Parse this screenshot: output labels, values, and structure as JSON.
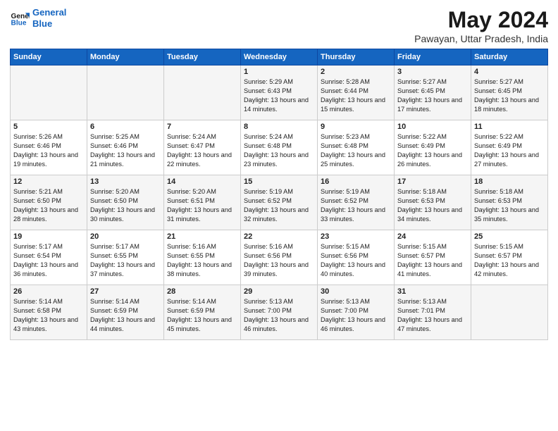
{
  "logo": {
    "line1": "General",
    "line2": "Blue"
  },
  "title": "May 2024",
  "location": "Pawayan, Uttar Pradesh, India",
  "days_of_week": [
    "Sunday",
    "Monday",
    "Tuesday",
    "Wednesday",
    "Thursday",
    "Friday",
    "Saturday"
  ],
  "weeks": [
    [
      {
        "day": "",
        "sunrise": "",
        "sunset": "",
        "daylight": ""
      },
      {
        "day": "",
        "sunrise": "",
        "sunset": "",
        "daylight": ""
      },
      {
        "day": "",
        "sunrise": "",
        "sunset": "",
        "daylight": ""
      },
      {
        "day": "1",
        "sunrise": "Sunrise: 5:29 AM",
        "sunset": "Sunset: 6:43 PM",
        "daylight": "Daylight: 13 hours and 14 minutes."
      },
      {
        "day": "2",
        "sunrise": "Sunrise: 5:28 AM",
        "sunset": "Sunset: 6:44 PM",
        "daylight": "Daylight: 13 hours and 15 minutes."
      },
      {
        "day": "3",
        "sunrise": "Sunrise: 5:27 AM",
        "sunset": "Sunset: 6:45 PM",
        "daylight": "Daylight: 13 hours and 17 minutes."
      },
      {
        "day": "4",
        "sunrise": "Sunrise: 5:27 AM",
        "sunset": "Sunset: 6:45 PM",
        "daylight": "Daylight: 13 hours and 18 minutes."
      }
    ],
    [
      {
        "day": "5",
        "sunrise": "Sunrise: 5:26 AM",
        "sunset": "Sunset: 6:46 PM",
        "daylight": "Daylight: 13 hours and 19 minutes."
      },
      {
        "day": "6",
        "sunrise": "Sunrise: 5:25 AM",
        "sunset": "Sunset: 6:46 PM",
        "daylight": "Daylight: 13 hours and 21 minutes."
      },
      {
        "day": "7",
        "sunrise": "Sunrise: 5:24 AM",
        "sunset": "Sunset: 6:47 PM",
        "daylight": "Daylight: 13 hours and 22 minutes."
      },
      {
        "day": "8",
        "sunrise": "Sunrise: 5:24 AM",
        "sunset": "Sunset: 6:48 PM",
        "daylight": "Daylight: 13 hours and 23 minutes."
      },
      {
        "day": "9",
        "sunrise": "Sunrise: 5:23 AM",
        "sunset": "Sunset: 6:48 PM",
        "daylight": "Daylight: 13 hours and 25 minutes."
      },
      {
        "day": "10",
        "sunrise": "Sunrise: 5:22 AM",
        "sunset": "Sunset: 6:49 PM",
        "daylight": "Daylight: 13 hours and 26 minutes."
      },
      {
        "day": "11",
        "sunrise": "Sunrise: 5:22 AM",
        "sunset": "Sunset: 6:49 PM",
        "daylight": "Daylight: 13 hours and 27 minutes."
      }
    ],
    [
      {
        "day": "12",
        "sunrise": "Sunrise: 5:21 AM",
        "sunset": "Sunset: 6:50 PM",
        "daylight": "Daylight: 13 hours and 28 minutes."
      },
      {
        "day": "13",
        "sunrise": "Sunrise: 5:20 AM",
        "sunset": "Sunset: 6:50 PM",
        "daylight": "Daylight: 13 hours and 30 minutes."
      },
      {
        "day": "14",
        "sunrise": "Sunrise: 5:20 AM",
        "sunset": "Sunset: 6:51 PM",
        "daylight": "Daylight: 13 hours and 31 minutes."
      },
      {
        "day": "15",
        "sunrise": "Sunrise: 5:19 AM",
        "sunset": "Sunset: 6:52 PM",
        "daylight": "Daylight: 13 hours and 32 minutes."
      },
      {
        "day": "16",
        "sunrise": "Sunrise: 5:19 AM",
        "sunset": "Sunset: 6:52 PM",
        "daylight": "Daylight: 13 hours and 33 minutes."
      },
      {
        "day": "17",
        "sunrise": "Sunrise: 5:18 AM",
        "sunset": "Sunset: 6:53 PM",
        "daylight": "Daylight: 13 hours and 34 minutes."
      },
      {
        "day": "18",
        "sunrise": "Sunrise: 5:18 AM",
        "sunset": "Sunset: 6:53 PM",
        "daylight": "Daylight: 13 hours and 35 minutes."
      }
    ],
    [
      {
        "day": "19",
        "sunrise": "Sunrise: 5:17 AM",
        "sunset": "Sunset: 6:54 PM",
        "daylight": "Daylight: 13 hours and 36 minutes."
      },
      {
        "day": "20",
        "sunrise": "Sunrise: 5:17 AM",
        "sunset": "Sunset: 6:55 PM",
        "daylight": "Daylight: 13 hours and 37 minutes."
      },
      {
        "day": "21",
        "sunrise": "Sunrise: 5:16 AM",
        "sunset": "Sunset: 6:55 PM",
        "daylight": "Daylight: 13 hours and 38 minutes."
      },
      {
        "day": "22",
        "sunrise": "Sunrise: 5:16 AM",
        "sunset": "Sunset: 6:56 PM",
        "daylight": "Daylight: 13 hours and 39 minutes."
      },
      {
        "day": "23",
        "sunrise": "Sunrise: 5:15 AM",
        "sunset": "Sunset: 6:56 PM",
        "daylight": "Daylight: 13 hours and 40 minutes."
      },
      {
        "day": "24",
        "sunrise": "Sunrise: 5:15 AM",
        "sunset": "Sunset: 6:57 PM",
        "daylight": "Daylight: 13 hours and 41 minutes."
      },
      {
        "day": "25",
        "sunrise": "Sunrise: 5:15 AM",
        "sunset": "Sunset: 6:57 PM",
        "daylight": "Daylight: 13 hours and 42 minutes."
      }
    ],
    [
      {
        "day": "26",
        "sunrise": "Sunrise: 5:14 AM",
        "sunset": "Sunset: 6:58 PM",
        "daylight": "Daylight: 13 hours and 43 minutes."
      },
      {
        "day": "27",
        "sunrise": "Sunrise: 5:14 AM",
        "sunset": "Sunset: 6:59 PM",
        "daylight": "Daylight: 13 hours and 44 minutes."
      },
      {
        "day": "28",
        "sunrise": "Sunrise: 5:14 AM",
        "sunset": "Sunset: 6:59 PM",
        "daylight": "Daylight: 13 hours and 45 minutes."
      },
      {
        "day": "29",
        "sunrise": "Sunrise: 5:13 AM",
        "sunset": "Sunset: 7:00 PM",
        "daylight": "Daylight: 13 hours and 46 minutes."
      },
      {
        "day": "30",
        "sunrise": "Sunrise: 5:13 AM",
        "sunset": "Sunset: 7:00 PM",
        "daylight": "Daylight: 13 hours and 46 minutes."
      },
      {
        "day": "31",
        "sunrise": "Sunrise: 5:13 AM",
        "sunset": "Sunset: 7:01 PM",
        "daylight": "Daylight: 13 hours and 47 minutes."
      },
      {
        "day": "",
        "sunrise": "",
        "sunset": "",
        "daylight": ""
      }
    ]
  ]
}
